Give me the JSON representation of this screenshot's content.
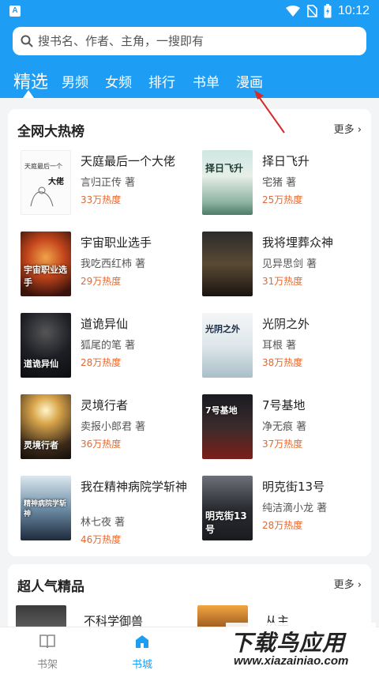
{
  "status_bar": {
    "time": "10:12",
    "app_badge": "A"
  },
  "search": {
    "placeholder": "搜书名、作者、主角，一搜即有"
  },
  "tabs": [
    "精选",
    "男频",
    "女频",
    "排行",
    "书单",
    "漫画"
  ],
  "active_tab_index": 0,
  "hot_list": {
    "title": "全网大热榜",
    "more": "更多",
    "books": [
      {
        "title": "天庭最后一个大佬",
        "author": "言归正传 著",
        "heat": "33万热度",
        "cover_text_1": "天庭最后一个",
        "cover_text_2": "大佬"
      },
      {
        "title": "择日飞升",
        "author": "宅猪 著",
        "heat": "25万热度",
        "cover_text": "择日飞升"
      },
      {
        "title": "宇宙职业选手",
        "author": "我吃西红柿 著",
        "heat": "29万热度",
        "cover_text": "宇宙职业选手"
      },
      {
        "title": "我将埋葬众神",
        "author": "见异思剑 著",
        "heat": "31万热度"
      },
      {
        "title": "道诡异仙",
        "author": "狐尾的笔 著",
        "heat": "28万热度",
        "cover_text": "道诡异仙"
      },
      {
        "title": "光阴之外",
        "author": "耳根 著",
        "heat": "38万热度",
        "cover_text": "光阴之外"
      },
      {
        "title": "灵境行者",
        "author": "卖报小郎君 著",
        "heat": "36万热度",
        "cover_text": "灵境行者"
      },
      {
        "title": "7号基地",
        "author": "净无痕 著",
        "heat": "37万热度",
        "cover_text": "7号基地"
      },
      {
        "title": "我在精神病院学斩神",
        "author": "林七夜 著",
        "heat": "46万热度",
        "cover_text": "精神病院学斩神"
      },
      {
        "title": "明克街13号",
        "author": "纯洁滴小龙 著",
        "heat": "28万热度",
        "cover_text": "明克街13号"
      }
    ]
  },
  "popular": {
    "title": "超人气精品",
    "more": "更多",
    "books": [
      {
        "title": "不科学御兽"
      },
      {
        "title": "从主"
      }
    ]
  },
  "bottom_nav": {
    "items": [
      {
        "label": "书架",
        "icon": "bookshelf-icon"
      },
      {
        "label": "书城",
        "icon": "bookstore-icon"
      }
    ],
    "active_index": 1
  },
  "watermark": {
    "main": "下载鸟应用",
    "sub": "www.xiazainiao.com"
  },
  "colors": {
    "header": "#1e9df5",
    "heat": "#e8672e",
    "active_nav": "#1e9df5",
    "inactive_nav": "#888888"
  }
}
